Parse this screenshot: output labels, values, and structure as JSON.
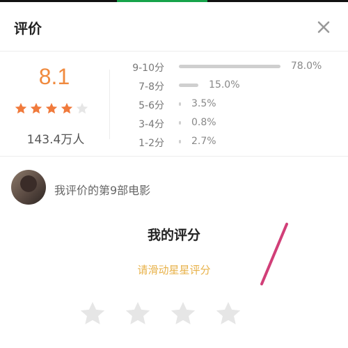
{
  "header": {
    "title": "评价",
    "close_icon": "close-icon"
  },
  "summary": {
    "score": "8.1",
    "stars_filled": 4,
    "stars_total": 5,
    "voters": "143.4万人",
    "distribution": [
      {
        "label": "9-10分",
        "value": "78.0%",
        "percent": 78.0
      },
      {
        "label": "7-8分",
        "value": "15.0%",
        "percent": 15.0
      },
      {
        "label": "5-6分",
        "value": "3.5%",
        "percent": 3.5
      },
      {
        "label": "3-4分",
        "value": "0.8%",
        "percent": 0.8
      },
      {
        "label": "1-2分",
        "value": "2.7%",
        "percent": 2.7
      }
    ]
  },
  "user": {
    "text": "我评价的第9部电影",
    "avatar_icon": "avatar"
  },
  "my_rating": {
    "title": "我的评分",
    "hint": "请滑动星星评分",
    "star_icon": "star-icon"
  },
  "colors": {
    "score": "#f08a3e",
    "star_filled": "#f07a3c",
    "star_empty": "#e6e6e6",
    "hint": "#e8b24a",
    "annotation_line": "#d13f78"
  }
}
